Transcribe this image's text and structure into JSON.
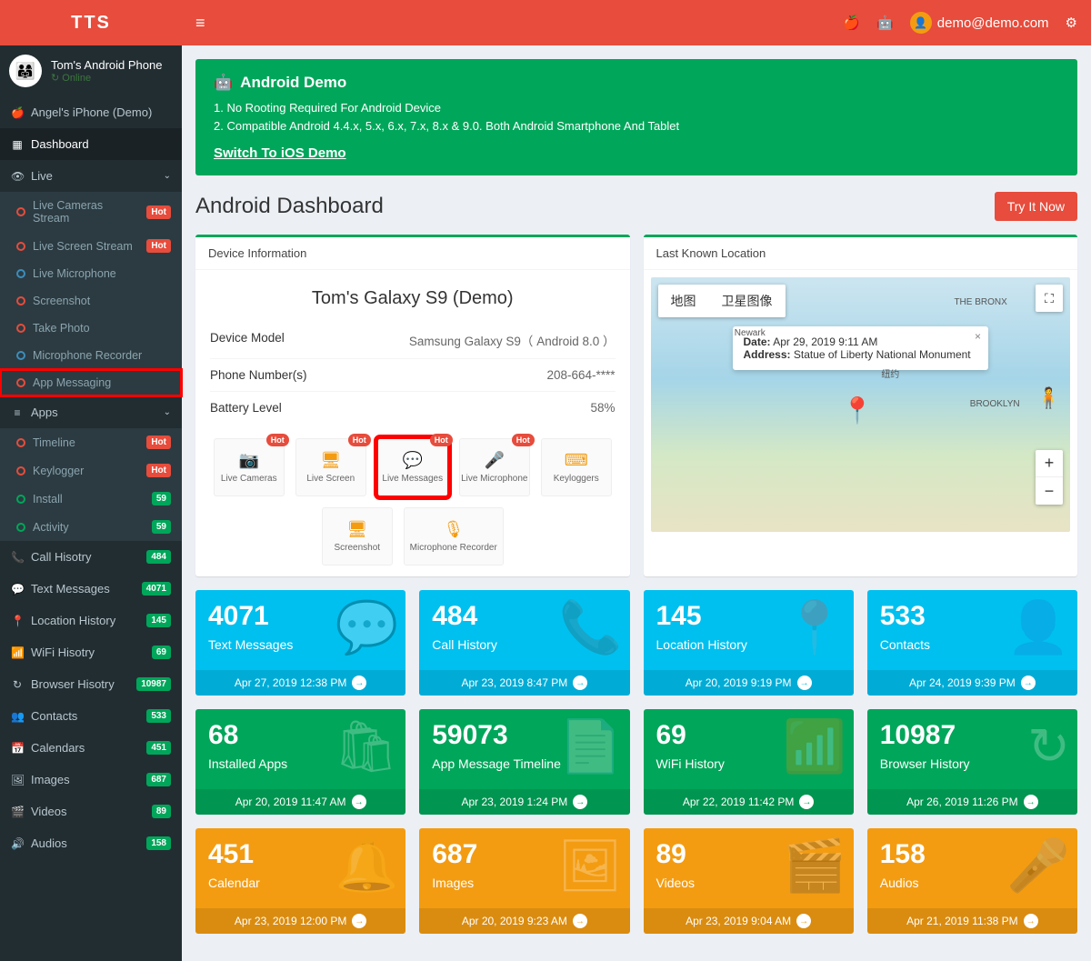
{
  "brand": "TTS",
  "user": {
    "device": "Tom's Android Phone",
    "status": "Online"
  },
  "sidebar": {
    "demo_device": "Angel's iPhone (Demo)",
    "dashboard": "Dashboard",
    "live": {
      "label": "Live",
      "items": [
        {
          "label": "Live Cameras Stream",
          "badge": "Hot"
        },
        {
          "label": "Live Screen Stream",
          "badge": "Hot"
        },
        {
          "label": "Live Microphone"
        },
        {
          "label": "Screenshot"
        },
        {
          "label": "Take Photo"
        },
        {
          "label": "Microphone Recorder"
        },
        {
          "label": "App Messaging"
        }
      ]
    },
    "apps": {
      "label": "Apps",
      "items": [
        {
          "label": "Timeline",
          "badge": "Hot"
        },
        {
          "label": "Keylogger",
          "badge": "Hot"
        },
        {
          "label": "Install",
          "badge": "59",
          "badge_class": "green"
        },
        {
          "label": "Activity",
          "badge": "59",
          "badge_class": "green"
        }
      ]
    },
    "main_items": [
      {
        "ico": "📞",
        "label": "Call Hisotry",
        "badge": "484"
      },
      {
        "ico": "💬",
        "label": "Text Messages",
        "badge": "4071"
      },
      {
        "ico": "📍",
        "label": "Location History",
        "badge": "145"
      },
      {
        "ico": "📶",
        "label": "WiFi Hisotry",
        "badge": "69"
      },
      {
        "ico": "↻",
        "label": "Browser Hisotry",
        "badge": "10987"
      },
      {
        "ico": "👥",
        "label": "Contacts",
        "badge": "533"
      },
      {
        "ico": "📅",
        "label": "Calendars",
        "badge": "451"
      },
      {
        "ico": "🖼",
        "label": "Images",
        "badge": "687"
      },
      {
        "ico": "🎬",
        "label": "Videos",
        "badge": "89"
      },
      {
        "ico": "🔊",
        "label": "Audios",
        "badge": "158"
      }
    ]
  },
  "topbar": {
    "email": "demo@demo.com"
  },
  "banner": {
    "title": "Android Demo",
    "line1": "1. No Rooting Required For Android Device",
    "line2": "2. Compatible Android 4.4.x, 5.x, 6.x, 7.x, 8.x & 9.0. Both Android Smartphone And Tablet",
    "link": "Switch To iOS Demo"
  },
  "page_title": "Android Dashboard",
  "try_button": "Try It Now",
  "device_info": {
    "header": "Device Information",
    "title": "Tom's Galaxy S9 (Demo)",
    "rows": {
      "model_k": "Device Model",
      "model_v": "Samsung Galaxy S9（ Android 8.0 ）",
      "phone_k": "Phone Number(s)",
      "phone_v": "208-664-****",
      "batt_k": "Battery Level",
      "batt_v": "58%"
    },
    "quick": [
      {
        "label": "Live Cameras",
        "hot": "Hot"
      },
      {
        "label": "Live Screen",
        "hot": "Hot"
      },
      {
        "label": "Live Messages",
        "hot": "Hot",
        "highlight": true
      },
      {
        "label": "Live Microphone",
        "hot": "Hot"
      },
      {
        "label": "Keyloggers"
      },
      {
        "label": "Screenshot"
      },
      {
        "label": "Microphone Recorder",
        "wide": true
      }
    ]
  },
  "location": {
    "header": "Last Known Location",
    "tab_map": "地图",
    "tab_sat": "卫星图像",
    "popup_date_k": "Date:",
    "popup_date_v": "Apr 29, 2019 9:11 AM",
    "popup_addr_k": "Address:",
    "popup_addr_v": "Statue of Liberty National Monument"
  },
  "metrics": [
    {
      "num": "4071",
      "label": "Text Messages",
      "footer": "Apr 27, 2019 12:38 PM",
      "color": "blue",
      "icon": "💬"
    },
    {
      "num": "484",
      "label": "Call History",
      "footer": "Apr 23, 2019 8:47 PM",
      "color": "blue",
      "icon": "📞"
    },
    {
      "num": "145",
      "label": "Location History",
      "footer": "Apr 20, 2019 9:19 PM",
      "color": "blue",
      "icon": "📍"
    },
    {
      "num": "533",
      "label": "Contacts",
      "footer": "Apr 24, 2019 9:39 PM",
      "color": "blue",
      "icon": "👤"
    },
    {
      "num": "68",
      "label": "Installed Apps",
      "footer": "Apr 20, 2019 11:47 AM",
      "color": "green",
      "icon": "🛍"
    },
    {
      "num": "59073",
      "label": "App Message Timeline",
      "footer": "Apr 23, 2019 1:24 PM",
      "color": "green",
      "icon": "📄"
    },
    {
      "num": "69",
      "label": "WiFi History",
      "footer": "Apr 22, 2019 11:42 PM",
      "color": "green",
      "icon": "📶"
    },
    {
      "num": "10987",
      "label": "Browser History",
      "footer": "Apr 26, 2019 11:26 PM",
      "color": "green",
      "icon": "↻"
    },
    {
      "num": "451",
      "label": "Calendar",
      "footer": "Apr 23, 2019 12:00 PM",
      "color": "orange",
      "icon": "🔔"
    },
    {
      "num": "687",
      "label": "Images",
      "footer": "Apr 20, 2019 9:23 AM",
      "color": "orange",
      "icon": "🖼"
    },
    {
      "num": "89",
      "label": "Videos",
      "footer": "Apr 23, 2019 9:04 AM",
      "color": "orange",
      "icon": "🎬"
    },
    {
      "num": "158",
      "label": "Audios",
      "footer": "Apr 21, 2019 11:38 PM",
      "color": "orange",
      "icon": "🎤"
    }
  ]
}
